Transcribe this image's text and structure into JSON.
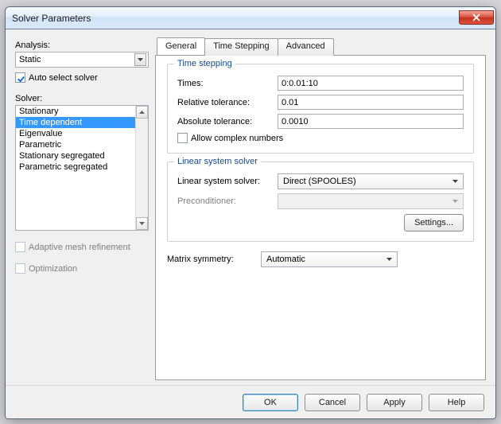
{
  "window": {
    "title": "Solver Parameters"
  },
  "left": {
    "analysis_label": "Analysis:",
    "analysis_value": "Static",
    "auto_select_label": "Auto select solver",
    "auto_select_checked": true,
    "solver_label": "Solver:",
    "solver_items": [
      "Stationary",
      "Time dependent",
      "Eigenvalue",
      "Parametric",
      "Stationary segregated",
      "Parametric segregated"
    ],
    "solver_selected_index": 1,
    "adaptive_label": "Adaptive mesh refinement",
    "optimization_label": "Optimization"
  },
  "tabs": {
    "items": [
      "General",
      "Time Stepping",
      "Advanced"
    ],
    "active": 0
  },
  "general": {
    "time_stepping": {
      "legend": "Time stepping",
      "times_label": "Times:",
      "times_value": "0:0.01:10",
      "reltol_label": "Relative tolerance:",
      "reltol_value": "0.01",
      "abstol_label": "Absolute tolerance:",
      "abstol_value": "0.0010",
      "allow_complex_label": "Allow complex numbers"
    },
    "linear_solver": {
      "legend": "Linear system solver",
      "solver_label": "Linear system solver:",
      "solver_value": "Direct (SPOOLES)",
      "preconditioner_label": "Preconditioner:",
      "preconditioner_value": "",
      "settings_button": "Settings..."
    },
    "matrix_symmetry_label": "Matrix symmetry:",
    "matrix_symmetry_value": "Automatic"
  },
  "buttons": {
    "ok": "OK",
    "cancel": "Cancel",
    "apply": "Apply",
    "help": "Help"
  }
}
